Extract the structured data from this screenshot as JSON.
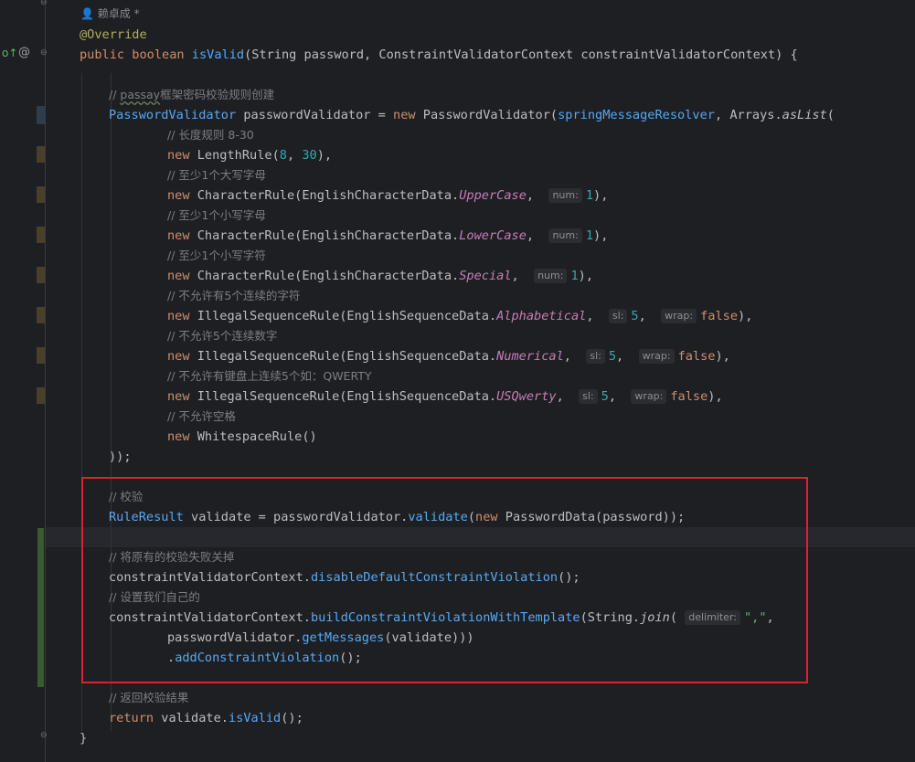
{
  "author": "赖卓成 *",
  "gutter_icons": {
    "override": "o↑",
    "at": "@"
  },
  "code": {
    "override": "@Override",
    "sig": {
      "public": "public",
      "boolean": "boolean",
      "name": "isValid",
      "p1": "(String password, ",
      "p1type": "ConstraintValidatorContext",
      "p1rest": " constraintValidatorContext) {"
    },
    "c_passay_prefix": "// ",
    "c_passay_word": "passay",
    "c_passay_rest": "框架密码校验规则创建",
    "pv_type": "PasswordValidator",
    "pv_var": " passwordValidator = ",
    "new": "new",
    "pv_ctor": "PasswordValidator",
    "pv_open": "(",
    "pv_resolver": "springMessageResolver",
    "pv_arrays": ", Arrays.",
    "pv_aslist": "asList",
    "pv_aslist_open": "(",
    "c_length": "// 长度规则 8-30",
    "length_rule": "LengthRule",
    "length_args_open": "(",
    "length_8": "8",
    "length_sep": ", ",
    "length_30": "30",
    "length_close": "),",
    "c_upper": "// 至少1个大写字母",
    "char_rule": "CharacterRule",
    "ecd": "(EnglishCharacterData.",
    "upper": "UpperCase",
    "comma": ",",
    "hint_num": "num:",
    "one": "1",
    "close_paren_comma": "),",
    "c_lower": "// 至少1个小写字母",
    "lower": "LowerCase",
    "c_special": "// 至少1个小写字符",
    "special": "Special",
    "c_alpha": "// 不允许有5个连续的字符",
    "isr": "IllegalSequenceRule",
    "esd": "(EnglishSequenceData.",
    "alpha": "Alphabetical",
    "hint_sl": "sl:",
    "five": "5",
    "hint_wrap": "wrap:",
    "false": "false",
    "c_num": "// 不允许5个连续数字",
    "numerical": "Numerical",
    "c_qwerty": "// 不允许有键盘上连续5个如：QWERTY",
    "usqwerty": "USQwerty",
    "c_space": "// 不允许空格",
    "ws_rule": "WhitespaceRule",
    "ws_parens": "()",
    "close_all": "));",
    "c_validate": "// 校验",
    "rr_type": "RuleResult",
    "rr_var": " validate = passwordValidator.",
    "rr_validate": "validate",
    "rr_open": "(",
    "pd": "PasswordData",
    "pd_args": "(password));",
    "c_disable": "// 将原有的校验失败关掉",
    "cvc": "constraintValidatorContext.",
    "disable": "disableDefaultConstraintViolation",
    "semi_call": "();",
    "c_set": "// 设置我们自己的",
    "build": "buildConstraintViolationWithTemplate",
    "build_open": "(String.",
    "join": "join",
    "join_open": "(",
    "hint_delim": "delimiter:",
    "delim_str": "\",\"",
    "pv_ref": "passwordValidator.",
    "get_msgs": "getMessages",
    "get_msgs_args": "(validate)))",
    "dot": ".",
    "add_cv": "addConstraintViolation",
    "c_return": "// 返回校验结果",
    "return": "return",
    "ret_rest": " validate.",
    "isvalid": "isValid",
    "ret_end": "();",
    "close_brace": "}"
  },
  "colors": {
    "keyword": "#cf8e6d",
    "annotation": "#b3ae60",
    "method": "#56a8f5",
    "comment": "#7a7e85",
    "number": "#2aacb8",
    "string": "#6aab73",
    "static_field": "#c77dbb",
    "highlight_box": "#d7262a",
    "background": "#1e1f22"
  }
}
